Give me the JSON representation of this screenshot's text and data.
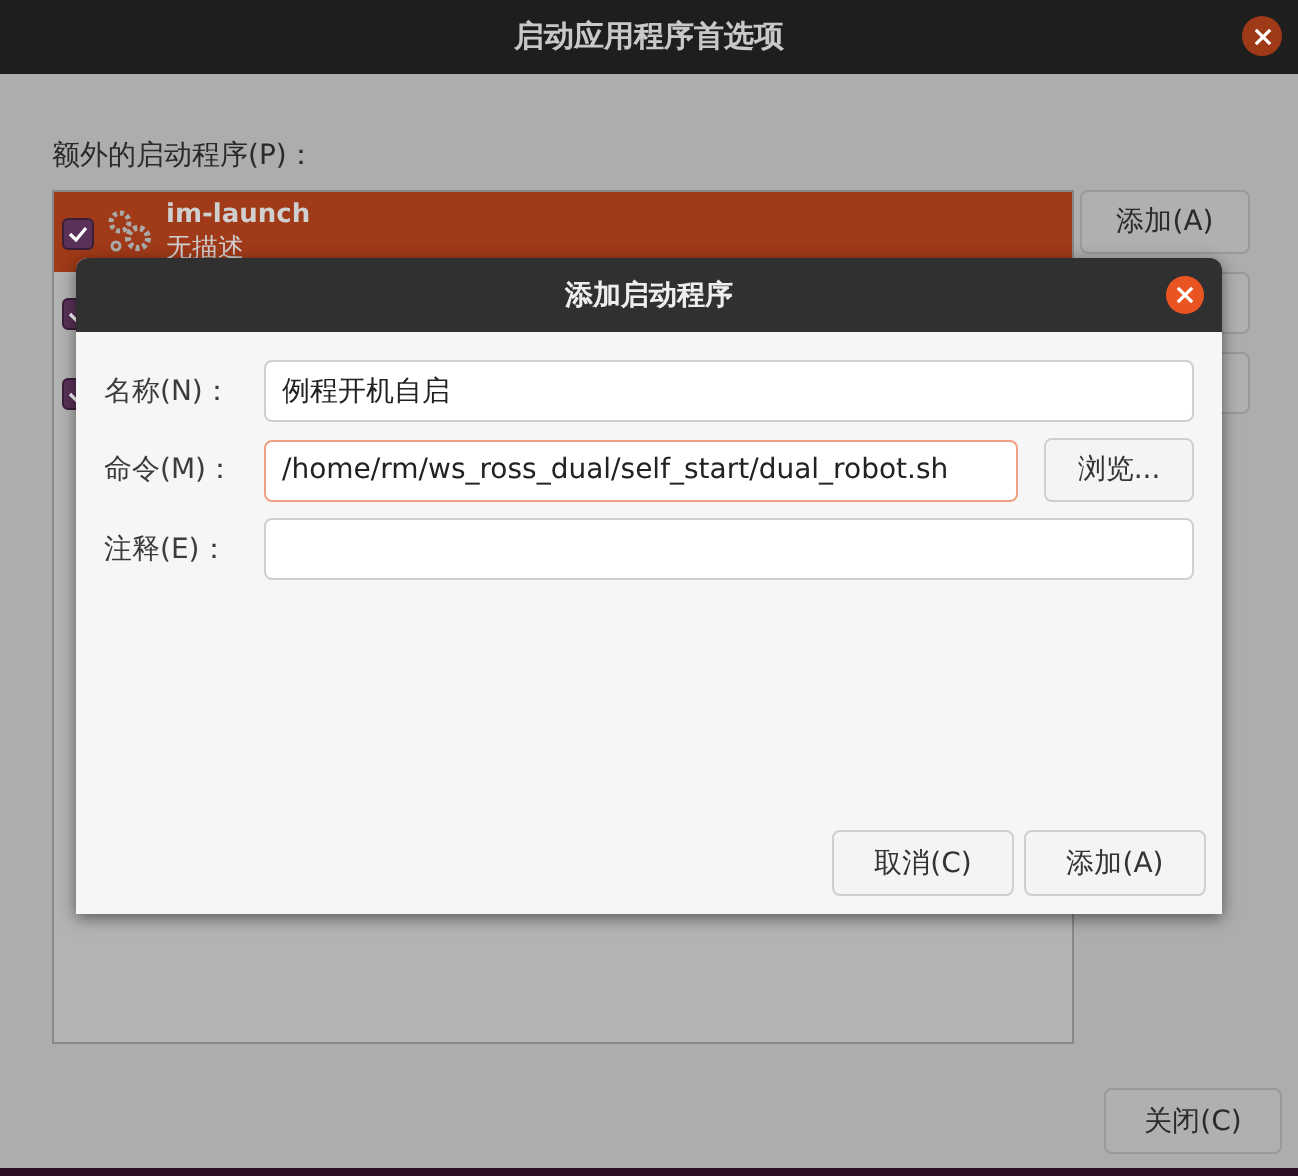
{
  "window": {
    "title": "启动应用程序首选项"
  },
  "list_label": "额外的启动程序(P)：",
  "programs": [
    {
      "name": "im-launch",
      "description": "无描述",
      "checked": true,
      "selected": true
    },
    {
      "checked": true,
      "selected": false
    },
    {
      "checked": true,
      "selected": false
    }
  ],
  "side_buttons": [
    {
      "label": "添加(A)"
    }
  ],
  "close_button": "关闭(C)",
  "dialog": {
    "title": "添加启动程序",
    "fields": [
      {
        "label": "名称(N)：",
        "value": "例程开机自启",
        "focused": false
      },
      {
        "label": "命令(M)：",
        "value": "/home/rm/ws_ross_dual/self_start/dual_robot.sh",
        "focused": true,
        "browse": "浏览..."
      },
      {
        "label": "注释(E)：",
        "focused": false
      }
    ],
    "buttons": [
      "取消(C)",
      "添加(A)"
    ]
  }
}
